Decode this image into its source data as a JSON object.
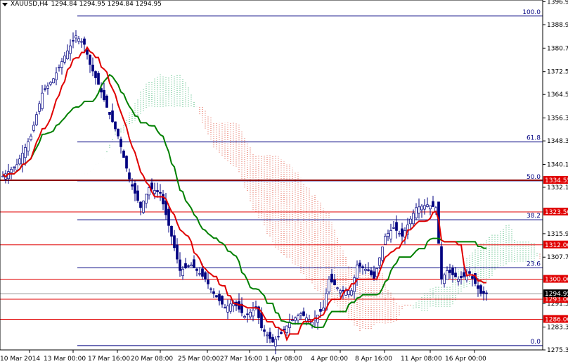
{
  "header": {
    "symbol": "XAUUSD,H4",
    "ohlc": "1294.84 1294.95 1294.84 1294.95"
  },
  "chart_data": {
    "type": "candlestick",
    "symbol": "XAUUSD",
    "timeframe": "H4",
    "ylim": [
      1275.3,
      1396.9
    ],
    "y_ticks": [
      "1396.90",
      "1388.90",
      "1380.70",
      "1372.50",
      "1364.50",
      "1356.30",
      "1348.30",
      "1340.10",
      "1332.10",
      "1315.90",
      "1307.70",
      "1291.50",
      "1283.30",
      "1275.30"
    ],
    "x_ticks": [
      "10 Mar 2014",
      "13 Mar 00:00",
      "17 Mar 16:00",
      "20 Mar 08:00",
      "25 Mar 00:00",
      "27 Mar 16:00",
      "1 Apr 08:00",
      "4 Apr 00:00",
      "8 Apr 16:00",
      "11 Apr 08:00",
      "16 Apr 00:00"
    ],
    "close_anchors": [
      [
        0,
        1336
      ],
      [
        5,
        1340
      ],
      [
        10,
        1350
      ],
      [
        14,
        1365
      ],
      [
        18,
        1370
      ],
      [
        22,
        1378
      ],
      [
        26,
        1385
      ],
      [
        29,
        1382
      ],
      [
        31,
        1375
      ],
      [
        34,
        1368
      ],
      [
        37,
        1360
      ],
      [
        41,
        1350
      ],
      [
        45,
        1335
      ],
      [
        49,
        1325
      ],
      [
        52,
        1332
      ],
      [
        56,
        1330
      ],
      [
        60,
        1315
      ],
      [
        63,
        1303
      ],
      [
        67,
        1305
      ],
      [
        72,
        1300
      ],
      [
        75,
        1295
      ],
      [
        79,
        1290
      ],
      [
        82,
        1292
      ],
      [
        86,
        1287
      ],
      [
        90,
        1290
      ],
      [
        92,
        1283
      ],
      [
        96,
        1278
      ],
      [
        99,
        1281
      ],
      [
        102,
        1285
      ],
      [
        106,
        1288
      ],
      [
        110,
        1285
      ],
      [
        114,
        1290
      ],
      [
        116,
        1300
      ],
      [
        120,
        1296
      ],
      [
        124,
        1296
      ],
      [
        126,
        1305
      ],
      [
        130,
        1303
      ],
      [
        132,
        1300
      ],
      [
        136,
        1315
      ],
      [
        139,
        1318
      ],
      [
        142,
        1315
      ],
      [
        147,
        1325
      ],
      [
        151,
        1326
      ],
      [
        154,
        1325
      ],
      [
        156,
        1300
      ],
      [
        158,
        1303
      ],
      [
        162,
        1300
      ],
      [
        166,
        1302
      ],
      [
        170,
        1295
      ],
      [
        172,
        1294.95
      ]
    ],
    "indicators": [
      "Ichimoku Tenkan-sen",
      "Ichimoku Kijun-sen",
      "Ichimoku Cloud"
    ],
    "levels": [
      {
        "price": 1334.55,
        "label": "1334.55",
        "color": "#8b0000"
      },
      {
        "price": 1323.5,
        "label": "1323.50",
        "color": "#e00000"
      },
      {
        "price": 1312.0,
        "label": "1312.00",
        "color": "#e00000"
      },
      {
        "price": 1300.0,
        "label": "1300.00",
        "color": "#e00000"
      },
      {
        "price": 1293.0,
        "label": "1293.00",
        "color": "#e00000"
      },
      {
        "price": 1286.0,
        "label": "1286.00",
        "color": "#e00000"
      }
    ],
    "current_price": {
      "price": 1294.95,
      "label": "1294.95"
    },
    "fibonacci": {
      "high": 1391.9,
      "low": 1276.8,
      "levels": [
        {
          "ratio": 1.0,
          "label": "100.0"
        },
        {
          "ratio": 0.618,
          "label": "61.8"
        },
        {
          "ratio": 0.5,
          "label": "50.0"
        },
        {
          "ratio": 0.382,
          "label": "38.2"
        },
        {
          "ratio": 0.236,
          "label": "23.6"
        },
        {
          "ratio": 0.0,
          "label": "0.0"
        }
      ]
    }
  }
}
